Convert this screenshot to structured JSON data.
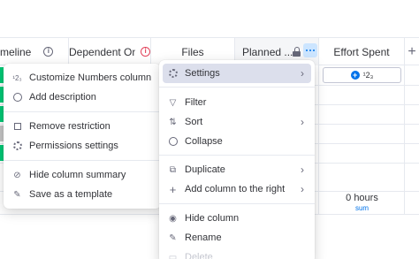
{
  "columns": {
    "timeline": "meline",
    "dependent_on": "Dependent On",
    "files": "Files",
    "planned": "Planned ...",
    "effort_spent": "Effort Spent",
    "add_column": "+"
  },
  "effort_cell": {
    "add_label": "¹2₃"
  },
  "summary": {
    "value": "0 hours",
    "label": "sum"
  },
  "left_menu": {
    "items": [
      {
        "label": "Customize Numbers column",
        "icon": "numbers-icon"
      },
      {
        "label": "Add description",
        "icon": "info-icon"
      },
      {
        "label": "Remove restriction",
        "icon": "unlock-icon"
      },
      {
        "label": "Permissions settings",
        "icon": "gear-icon"
      },
      {
        "label": "Hide column summary",
        "icon": "eye-off-icon"
      },
      {
        "label": "Save as a template",
        "icon": "template-icon"
      }
    ]
  },
  "right_menu": {
    "items": [
      {
        "label": "Settings",
        "icon": "gear-icon",
        "has_submenu": true,
        "active": true
      },
      {
        "label": "Filter",
        "icon": "filter-icon"
      },
      {
        "label": "Sort",
        "icon": "sort-icon",
        "has_submenu": true
      },
      {
        "label": "Collapse",
        "icon": "collapse-icon"
      },
      {
        "label": "Duplicate",
        "icon": "duplicate-icon",
        "has_submenu": true
      },
      {
        "label": "Add column to the right",
        "icon": "plus-icon",
        "has_submenu": true
      },
      {
        "label": "Hide column",
        "icon": "eye-icon"
      },
      {
        "label": "Rename",
        "icon": "pencil-icon"
      },
      {
        "label": "Delete",
        "icon": "trash-icon"
      }
    ]
  },
  "colors": {
    "accent": "#0073ea",
    "status_green": "#00c875",
    "danger": "#e2445c",
    "active_item": "#dcdfec"
  }
}
